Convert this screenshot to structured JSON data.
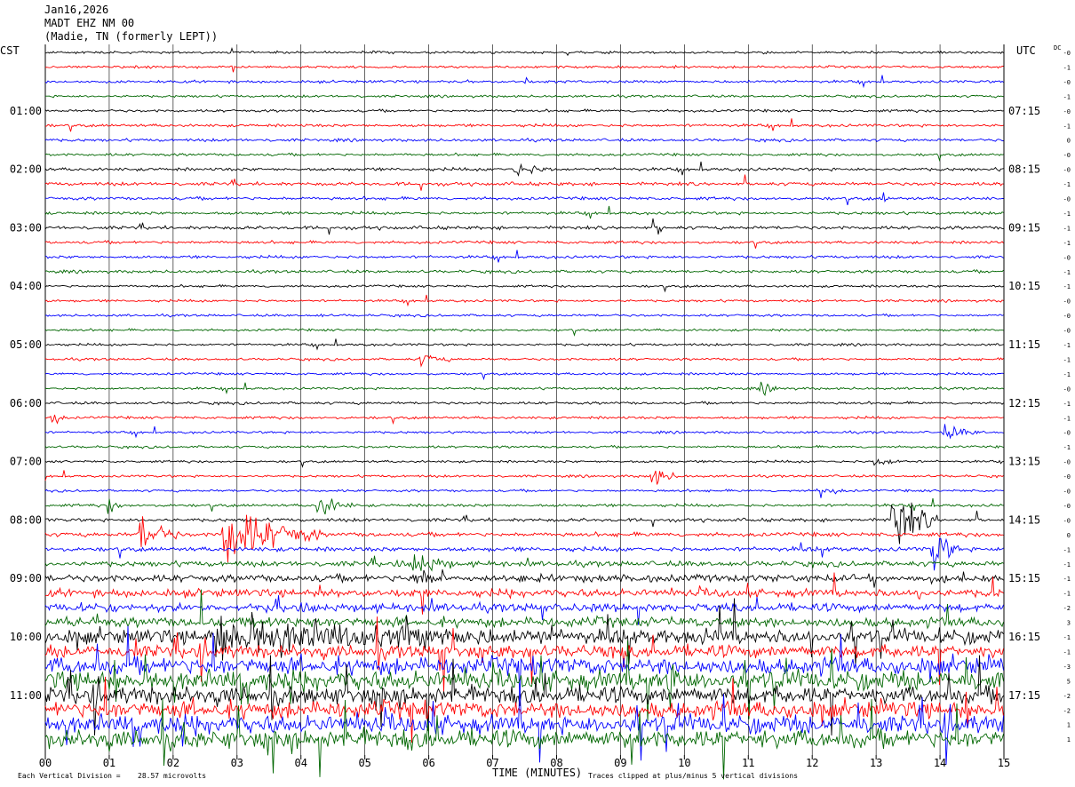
{
  "header": {
    "date": "Jan16,2026",
    "station": "MADT EHZ NM 00",
    "location": "(Madie, TN (formerly LEPT))"
  },
  "colors": {
    "trace_cycle": [
      "#000000",
      "#ff0000",
      "#0000ff",
      "#006600"
    ],
    "grid": "#000000",
    "background": "#ffffff"
  },
  "chart_data": {
    "type": "line",
    "title": "MADT EHZ NM 00",
    "xlabel": "TIME (MINUTES)",
    "ylabel": "",
    "left_axis_label": "CST",
    "right_axis_label": "UTC",
    "dc_label": "DC",
    "x_ticks": [
      "00",
      "01",
      "02",
      "03",
      "04",
      "05",
      "06",
      "07",
      "08",
      "09",
      "10",
      "11",
      "12",
      "13",
      "14",
      "15"
    ],
    "xlim": [
      0,
      15
    ],
    "line_count": 48,
    "minutes_per_line": 15,
    "left_hour_labels": [
      {
        "line": 4,
        "label": "01:00"
      },
      {
        "line": 8,
        "label": "02:00"
      },
      {
        "line": 12,
        "label": "03:00"
      },
      {
        "line": 16,
        "label": "04:00"
      },
      {
        "line": 20,
        "label": "05:00"
      },
      {
        "line": 24,
        "label": "06:00"
      },
      {
        "line": 28,
        "label": "07:00"
      },
      {
        "line": 32,
        "label": "08:00"
      },
      {
        "line": 36,
        "label": "09:00"
      },
      {
        "line": 40,
        "label": "10:00"
      },
      {
        "line": 44,
        "label": "11:00"
      }
    ],
    "right_hour_labels": [
      {
        "line": 4,
        "label": "07:15"
      },
      {
        "line": 8,
        "label": "08:15"
      },
      {
        "line": 12,
        "label": "09:15"
      },
      {
        "line": 16,
        "label": "10:15"
      },
      {
        "line": 20,
        "label": "11:15"
      },
      {
        "line": 24,
        "label": "12:15"
      },
      {
        "line": 28,
        "label": "13:15"
      },
      {
        "line": 32,
        "label": "14:15"
      },
      {
        "line": 36,
        "label": "15:15"
      },
      {
        "line": 40,
        "label": "16:15"
      },
      {
        "line": 44,
        "label": "17:15"
      }
    ],
    "dc_offsets": [
      "-0",
      "-1",
      "-0",
      "-1",
      "-0",
      "-1",
      "0",
      "-0",
      "-0",
      "-1",
      "-0",
      "-1",
      "-1",
      "-1",
      "-0",
      "-1",
      "-1",
      "-0",
      "-0",
      "-0",
      "-1",
      "-1",
      "-1",
      "-0",
      "-1",
      "-1",
      "-0",
      "-1",
      "-0",
      "-0",
      "-0",
      "-0",
      "-0",
      "0",
      "-1",
      "-1",
      "-1",
      "-1",
      "-2",
      "3",
      "-1",
      "-1",
      "-3",
      "5",
      "-2",
      "-2",
      "1",
      "1"
    ],
    "activity": {
      "amplitude_per_line": [
        1.0,
        1.0,
        1.1,
        1.0,
        1.1,
        1.2,
        1.2,
        1.1,
        1.3,
        1.4,
        1.3,
        1.2,
        1.4,
        1.2,
        1.2,
        1.2,
        1.0,
        1.0,
        1.0,
        1.0,
        1.0,
        1.0,
        1.0,
        1.0,
        1.1,
        1.1,
        1.0,
        1.0,
        1.0,
        1.0,
        1.0,
        1.2,
        1.4,
        1.7,
        1.8,
        2.2,
        3.0,
        3.2,
        3.4,
        4.0,
        6.0,
        5.2,
        7.0,
        8.0,
        7.0,
        7.0,
        7.5,
        7.5
      ],
      "events": [
        {
          "line": 2,
          "minute": 7.5,
          "amp": 8
        },
        {
          "line": 8,
          "minute": 7.4,
          "amp": 6,
          "dur": 0.6
        },
        {
          "line": 10,
          "minute": 13.1,
          "amp": 12
        },
        {
          "line": 12,
          "minute": 9.6,
          "amp": 10
        },
        {
          "line": 18,
          "minute": 4.3,
          "amp": 6
        },
        {
          "line": 21,
          "minute": 5.9,
          "amp": 5,
          "dur": 0.5
        },
        {
          "line": 23,
          "minute": 11.2,
          "amp": 5,
          "dur": 0.4
        },
        {
          "line": 25,
          "minute": 0.1,
          "amp": 10,
          "dur": 0.2
        },
        {
          "line": 26,
          "minute": 14.1,
          "amp": 6,
          "dur": 0.6
        },
        {
          "line": 28,
          "minute": 13.0,
          "amp": 5,
          "dur": 0.5
        },
        {
          "line": 29,
          "minute": 9.5,
          "amp": 12,
          "dur": 0.4
        },
        {
          "line": 30,
          "minute": 12.1,
          "amp": 7,
          "dur": 0.4
        },
        {
          "line": 31,
          "minute": 4.3,
          "amp": 12,
          "dur": 0.5
        },
        {
          "line": 31,
          "minute": 1.0,
          "amp": 8,
          "dur": 0.2
        },
        {
          "line": 32,
          "minute": 13.3,
          "amp": 30,
          "dur": 0.7
        },
        {
          "line": 33,
          "minute": 1.5,
          "amp": 20,
          "dur": 0.6
        },
        {
          "line": 33,
          "minute": 2.9,
          "amp": 30,
          "dur": 1.4
        },
        {
          "line": 34,
          "minute": 13.9,
          "amp": 25,
          "dur": 0.4
        },
        {
          "line": 35,
          "minute": 5.8,
          "amp": 12,
          "dur": 0.6
        },
        {
          "line": 36,
          "minute": 5.8,
          "amp": 10,
          "dur": 0.5
        },
        {
          "line": 40,
          "minute": 3.0,
          "amp": 14,
          "dur": 4.0
        },
        {
          "line": 43,
          "minute": 9.7,
          "amp": 20,
          "dur": 0.4
        }
      ]
    }
  },
  "footer": {
    "vertical_division_label": "Each Vertical Division =",
    "vertical_division_value": "28.57 microvolts",
    "xlabel": "TIME (MINUTES)",
    "clip_note": "Traces clipped at plus/minus 5 vertical divisions"
  }
}
